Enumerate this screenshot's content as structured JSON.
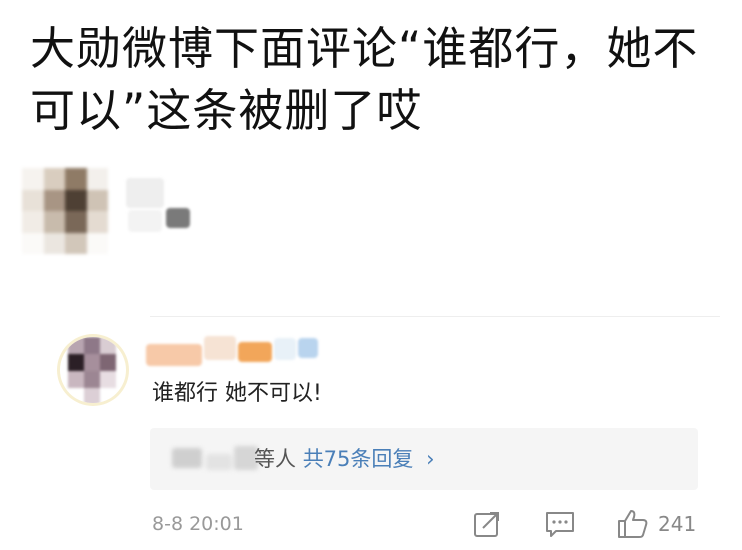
{
  "post": {
    "headline": "大勋微博下面评论“谁都行，她不可以”这条被删了哎"
  },
  "comment": {
    "text": "谁都行 她不可以!",
    "replies_suffix": "等人",
    "replies_count": "共75条回复",
    "chevron": "›",
    "timestamp": "8-8 20:01",
    "like_count": "241"
  },
  "icons": {
    "share": "share-icon",
    "comment": "comment-icon",
    "like": "thumbs-up-icon"
  },
  "colors": {
    "link": "#4a7fb8",
    "text": "#222222",
    "muted": "#999999",
    "reply_bg": "#f5f5f5"
  }
}
